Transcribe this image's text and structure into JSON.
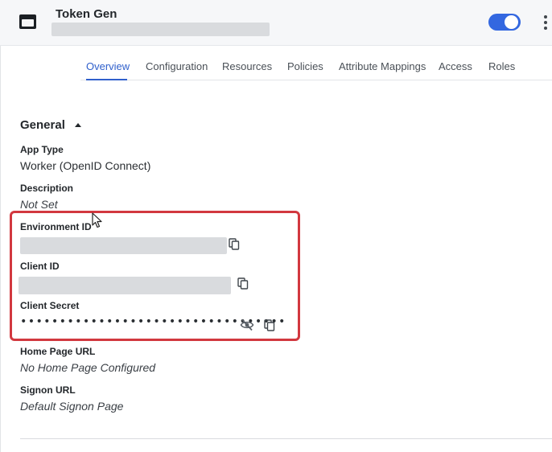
{
  "header": {
    "app_icon": "app-window-icon",
    "title": "Token Gen",
    "toggle_enabled": true,
    "more_icon": "kebab-menu-icon"
  },
  "tabs": [
    {
      "label": "Overview",
      "active": true
    },
    {
      "label": "Configuration",
      "active": false
    },
    {
      "label": "Resources",
      "active": false
    },
    {
      "label": "Policies",
      "active": false
    },
    {
      "label": "Attribute Mappings",
      "active": false
    },
    {
      "label": "Access",
      "active": false
    },
    {
      "label": "Roles",
      "active": false
    }
  ],
  "general": {
    "title": "General",
    "collapse_icon": "caret-up-icon",
    "fields": {
      "app_type": {
        "label": "App Type",
        "value": "Worker (OpenID Connect)"
      },
      "description": {
        "label": "Description",
        "value": "Not Set"
      },
      "environment_id": {
        "label": "Environment ID",
        "copy_icon": "copy-icon"
      },
      "client_id": {
        "label": "Client ID",
        "copy_icon": "copy-icon"
      },
      "client_secret": {
        "label": "Client Secret",
        "masked_value": "••••••••••••••••••••••••••••••••••",
        "reveal_icon": "eye-off-icon",
        "copy_icon": "copy-icon"
      },
      "home_page_url": {
        "label": "Home Page URL",
        "value": "No Home Page Configured"
      },
      "signon_url": {
        "label": "Signon URL",
        "value": "Default Signon Page"
      }
    }
  },
  "colors": {
    "accent": "#3060cc",
    "toggle": "#3367e0",
    "highlight_border": "#d2383f"
  }
}
